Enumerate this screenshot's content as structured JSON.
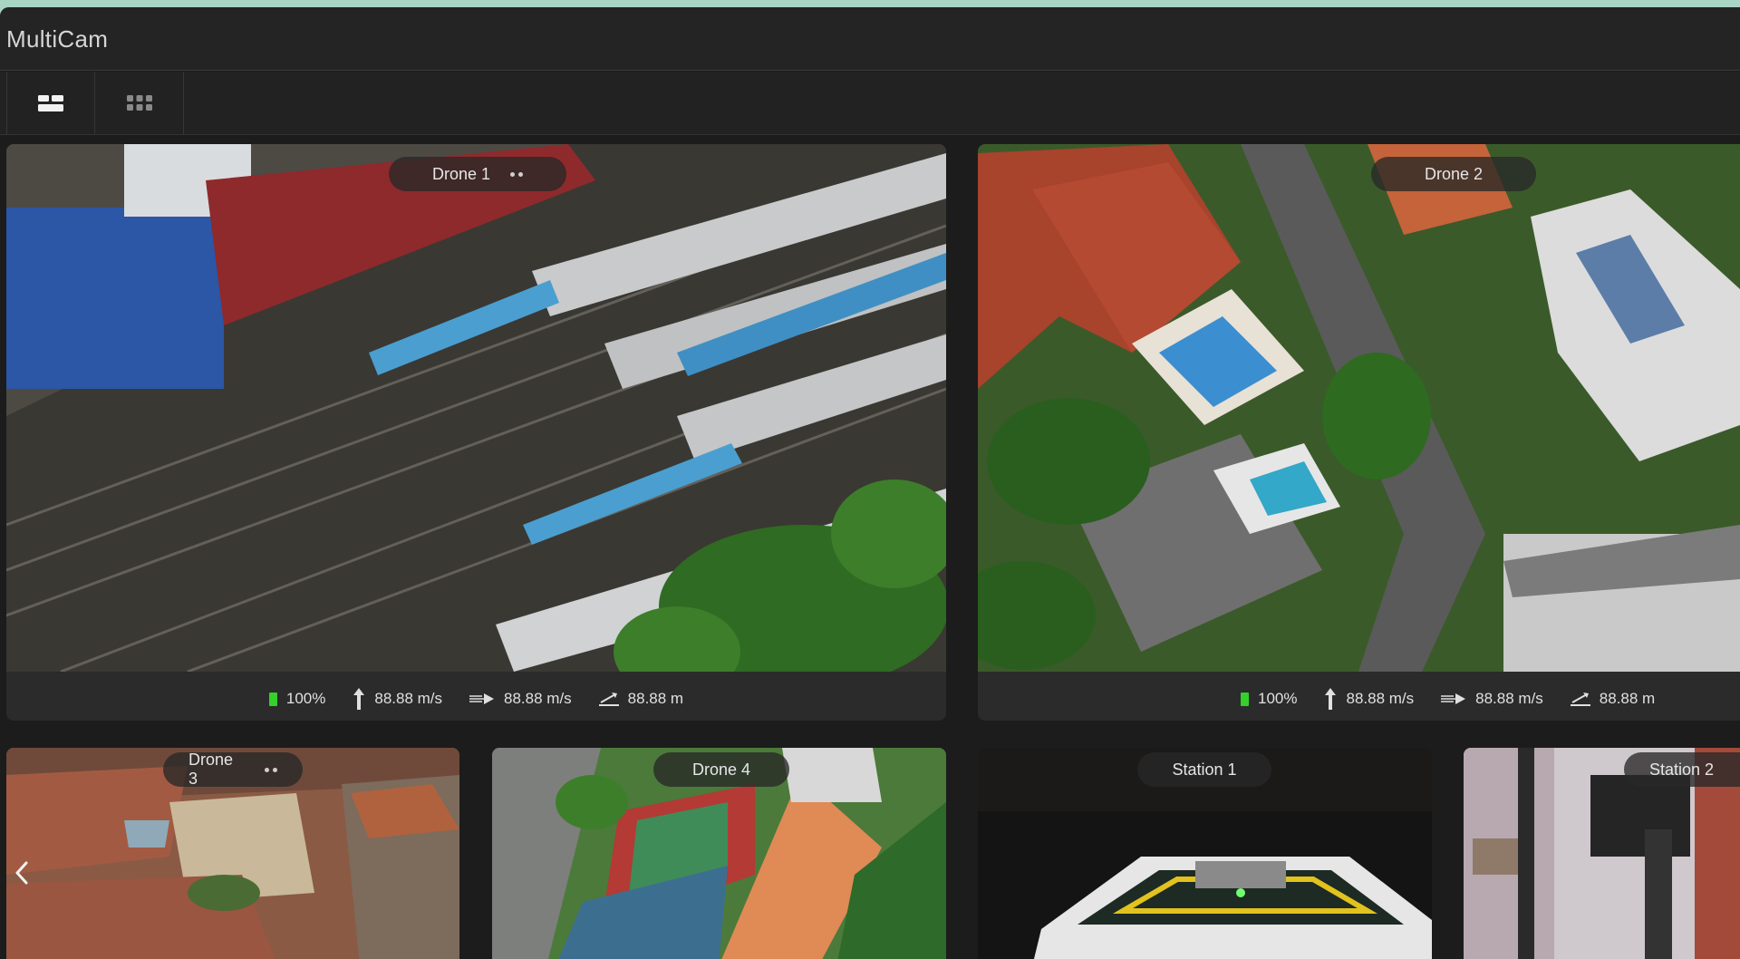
{
  "app": {
    "title": "MultiCam"
  },
  "toolbar": {
    "layout_large_icon": "layout-large-grid-icon",
    "layout_small_icon": "layout-small-grid-icon"
  },
  "feeds": [
    {
      "name": "Drone 1",
      "has_menu": true,
      "battery": "100%",
      "vertical_speed": "88.88 m/s",
      "horizontal_speed": "88.88 m/s",
      "altitude": "88.88 m"
    },
    {
      "name": "Drone 2",
      "has_menu": false,
      "battery": "100%",
      "vertical_speed": "88.88 m/s",
      "horizontal_speed": "88.88 m/s",
      "altitude": "88.88 m"
    },
    {
      "name": "Drone 3",
      "has_menu": true
    },
    {
      "name": "Drone 4",
      "has_menu": false
    },
    {
      "name": "Station 1",
      "has_menu": false
    },
    {
      "name": "Station 2",
      "has_menu": false
    }
  ],
  "colors": {
    "battery": "#34d02c",
    "background": "#1c1c1c",
    "panel": "#2b2b2b"
  }
}
